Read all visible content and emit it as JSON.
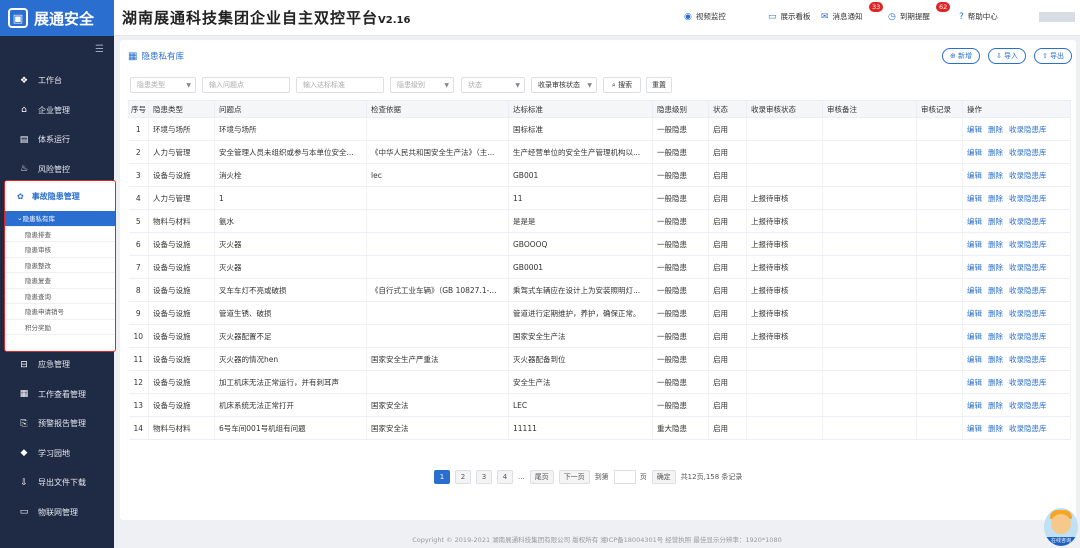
{
  "app": {
    "logo_text": "展通安全",
    "title": "湖南展通科技集团企业自主双控平台",
    "version": "V2.16"
  },
  "topnav": [
    {
      "label": "视频监控",
      "icon": "camera-icon"
    },
    {
      "label": "展示看板",
      "icon": "monitor-icon"
    },
    {
      "label": "消息通知",
      "icon": "message-icon",
      "badge": "33"
    },
    {
      "label": "到期提醒",
      "icon": "clock-icon",
      "badge": "62"
    },
    {
      "label": "帮助中心",
      "icon": "help-icon"
    }
  ],
  "sidebar": {
    "top_items": [
      {
        "label": "工作台",
        "icon": "dashboard-icon"
      },
      {
        "label": "企业管理",
        "icon": "home-icon"
      },
      {
        "label": "体系运行",
        "icon": "system-icon"
      },
      {
        "label": "风险管控",
        "icon": "fire-icon"
      }
    ],
    "active_group": {
      "label": "事故隐患管理",
      "icon": "hazard-icon",
      "items": [
        "隐患私有库",
        "隐患排查",
        "隐患审核",
        "隐患整改",
        "隐患复查",
        "隐患查询",
        "隐患申请销号",
        "积分奖励"
      ],
      "active_index": 0
    },
    "bottom_items": [
      {
        "label": "应急管理",
        "icon": "emergency-icon"
      },
      {
        "label": "工作查看管理",
        "icon": "calendar-icon"
      },
      {
        "label": "预警报告管理",
        "icon": "report-icon"
      },
      {
        "label": "学习园地",
        "icon": "graduation-icon"
      },
      {
        "label": "导出文件下载",
        "icon": "download-icon"
      },
      {
        "label": "物联网管理",
        "icon": "iot-icon"
      }
    ]
  },
  "panel": {
    "title": "隐患私有库",
    "buttons": {
      "new": "新增",
      "import": "导入",
      "export": "导出"
    },
    "filters": {
      "hazard_type": "隐患类型",
      "problem": "输入问题点",
      "standard": "输入达标标准",
      "level": "隐患级别",
      "status": "状态",
      "audit": "收录审核状态",
      "search": "搜索",
      "reset": "重置"
    }
  },
  "table": {
    "headers": [
      "序号",
      "隐患类型",
      "问题点",
      "检查依据",
      "达标标准",
      "隐患级别",
      "状态",
      "收录审核状态",
      "审核备注",
      "审核记录",
      "操作"
    ],
    "actions": [
      "编辑",
      "删除",
      "收录隐患库"
    ],
    "rows": [
      [
        "1",
        "环境与场所",
        "环境与场所",
        "",
        "国标标准",
        "一般隐患",
        "启用",
        "",
        "",
        ""
      ],
      [
        "2",
        "人力与管理",
        "安全管理人员未组织或参与本单位安全...",
        "《中华人民共和国安全生产法》（主...",
        "生产经营单位的安全生产管理机构以...",
        "一般隐患",
        "启用",
        "",
        "",
        ""
      ],
      [
        "3",
        "设备与设施",
        "消火栓",
        "lec",
        "GB001",
        "一般隐患",
        "启用",
        "",
        "",
        ""
      ],
      [
        "4",
        "人力与管理",
        "1",
        "",
        "11",
        "一般隐患",
        "启用",
        "上报待审核",
        "",
        ""
      ],
      [
        "5",
        "物料与材料",
        "氨水",
        "",
        "是是是",
        "一般隐患",
        "启用",
        "上报待审核",
        "",
        ""
      ],
      [
        "6",
        "设备与设施",
        "灭火器",
        "",
        "GBOOOQ",
        "一般隐患",
        "启用",
        "上报待审核",
        "",
        ""
      ],
      [
        "7",
        "设备与设施",
        "灭火器",
        "",
        "GB0001",
        "一般隐患",
        "启用",
        "上报待审核",
        "",
        ""
      ],
      [
        "8",
        "设备与设施",
        "叉车车灯不亮或破损",
        "《自行式工业车辆》（GB 10827.1-...",
        "乘驾式车辆应在设计上为安装照明灯...",
        "一般隐患",
        "启用",
        "上报待审核",
        "",
        ""
      ],
      [
        "9",
        "设备与设施",
        "管道生锈、破损",
        "",
        "管道进行定期维护，养护，确保正常。",
        "一般隐患",
        "启用",
        "上报待审核",
        "",
        ""
      ],
      [
        "10",
        "设备与设施",
        "灭火器配置不足",
        "",
        "国家安全生产法",
        "一般隐患",
        "启用",
        "上报待审核",
        "",
        ""
      ],
      [
        "11",
        "设备与设施",
        "灭火器的情况hen",
        "国家安全生产严重法",
        "灭火器配备到位",
        "一般隐患",
        "启用",
        "",
        "",
        ""
      ],
      [
        "12",
        "设备与设施",
        "加工机床无法正常运行，并有刺耳声",
        "",
        "安全生产法",
        "一般隐患",
        "启用",
        "",
        "",
        ""
      ],
      [
        "13",
        "设备与设施",
        "机床系统无法正常打开",
        "国家安全法",
        "LEC",
        "一般隐患",
        "启用",
        "",
        "",
        ""
      ],
      [
        "14",
        "物料与材料",
        "6号车间001号机组有问题",
        "国家安全法",
        "11111",
        "重大隐患",
        "启用",
        "",
        "",
        ""
      ]
    ]
  },
  "pager": {
    "pages": [
      "1",
      "2",
      "3",
      "4"
    ],
    "ellipsis": "...",
    "first": "尾页",
    "next": "下一页",
    "goto": "到第",
    "page_unit": "页",
    "confirm": "确定",
    "total": "共12页,158 条记录"
  },
  "footer": "Copyright © 2019-2021 湖南展通科技集团有限公司 版权所有 湘ICP备18004301号 经营执照   最佳显示分辨率：1920*1080",
  "mascot_label": "在线咨询"
}
